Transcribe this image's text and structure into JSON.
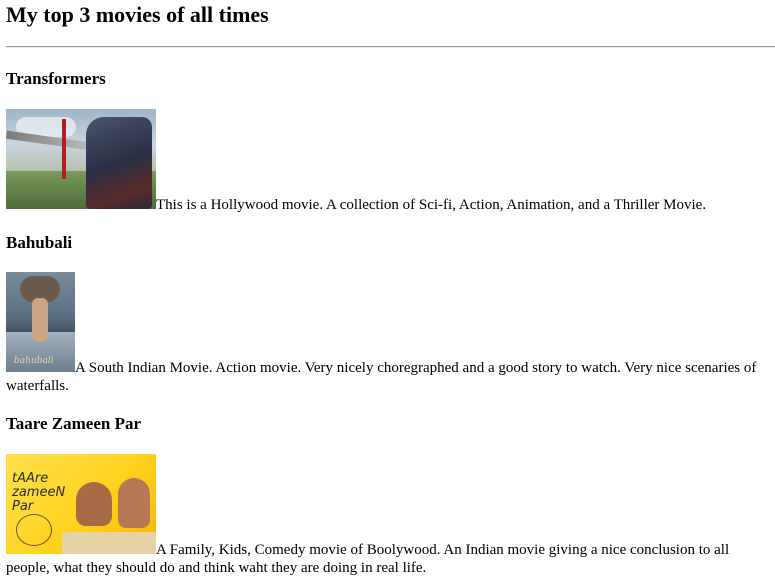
{
  "page": {
    "heading": "My top 3 movies of all times"
  },
  "movies": [
    {
      "title": "Transformers",
      "poster_icon": "transformers-poster-image",
      "description": "This is a Hollywood movie. A collection of Sci-fi, Action, Animation, and a Thriller Movie."
    },
    {
      "title": "Bahubali",
      "poster_icon": "bahubali-poster-image",
      "poster_caption": "bahubali",
      "description": "A South Indian Movie. Action movie. Very nicely choregraphed and a good story to watch. Very nice scenaries of waterfalls."
    },
    {
      "title": "Taare Zameen Par",
      "poster_icon": "taare-zameen-par-poster-image",
      "poster_caption": "tAAre\nzameeN\nPar",
      "description": "A Family, Kids, Comedy movie of Boolywood. An Indian movie giving a nice conclusion to all people, what they should do and think waht they are doing in real life."
    }
  ]
}
